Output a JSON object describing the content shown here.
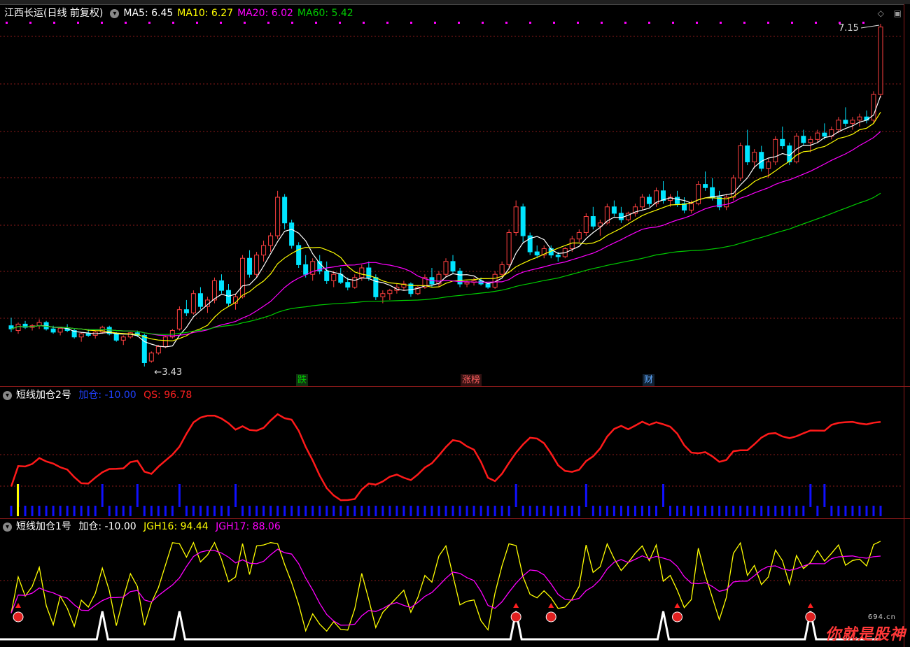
{
  "main": {
    "stock_title": "江西长运(日线 前复权)",
    "ma": [
      {
        "label": "MA5: 6.45",
        "color": "#ffffff"
      },
      {
        "label": "MA10: 6.27",
        "color": "#ffff00"
      },
      {
        "label": "MA20: 6.02",
        "color": "#ff00ff"
      },
      {
        "label": "MA60: 5.42",
        "color": "#00cc00"
      }
    ],
    "high_label": "7.15",
    "low_label": "3.43",
    "events": [
      {
        "label": "跌",
        "color": "#00cc00",
        "bg": "#113311"
      },
      {
        "label": "涨榜",
        "color": "#ff6060",
        "bg": "#331111"
      },
      {
        "label": "财",
        "color": "#5fa8ff",
        "bg": "#112233"
      }
    ]
  },
  "panel2": {
    "title": "短线加仓2号",
    "items": [
      {
        "label": "加仓: -10.00",
        "color": "#0000ff"
      },
      {
        "label": "QS: 96.78",
        "color": "#ff2020"
      }
    ]
  },
  "panel3": {
    "title": "短线加仓1号",
    "items": [
      {
        "label": "加仓: -10.00",
        "color": "#ffffff"
      },
      {
        "label": "JGH16: 94.44",
        "color": "#ffff00"
      },
      {
        "label": "JGH17: 88.06",
        "color": "#ff00ff"
      }
    ]
  },
  "toolbar": {
    "controls": [
      "◇",
      "▣"
    ]
  },
  "watermark": {
    "text": "你就是股神",
    "site": "694.cn"
  },
  "colors": {
    "up": "#ff4040",
    "down": "#00e5ff",
    "grid": "#8b1a1a"
  },
  "chart_data": {
    "type": "candlestick",
    "price_axis_shown": false,
    "candles": [
      [
        4.7,
        4.95,
        4.5,
        4.6
      ],
      [
        4.55,
        4.8,
        4.45,
        4.75
      ],
      [
        4.75,
        4.85,
        4.6,
        4.65
      ],
      [
        4.65,
        4.75,
        4.55,
        4.7
      ],
      [
        4.7,
        4.9,
        4.6,
        4.8
      ],
      [
        4.8,
        4.85,
        4.55,
        4.6
      ],
      [
        4.6,
        4.7,
        4.45,
        4.5
      ],
      [
        4.5,
        4.65,
        4.4,
        4.62
      ],
      [
        4.62,
        4.75,
        4.5,
        4.55
      ],
      [
        4.55,
        4.6,
        4.3,
        4.35
      ],
      [
        4.35,
        4.5,
        4.2,
        4.45
      ],
      [
        4.45,
        4.6,
        4.35,
        4.4
      ],
      [
        4.4,
        4.55,
        4.3,
        4.5
      ],
      [
        4.5,
        4.7,
        4.45,
        4.65
      ],
      [
        4.65,
        4.7,
        4.4,
        4.45
      ],
      [
        4.45,
        4.5,
        4.2,
        4.25
      ],
      [
        4.25,
        4.4,
        4.1,
        4.35
      ],
      [
        4.35,
        4.5,
        4.3,
        4.48
      ],
      [
        4.48,
        4.55,
        4.35,
        4.4
      ],
      [
        4.4,
        4.45,
        3.43,
        3.55
      ],
      [
        3.6,
        3.9,
        3.55,
        3.85
      ],
      [
        3.85,
        4.1,
        3.8,
        4.05
      ],
      [
        4.05,
        4.4,
        4.0,
        4.35
      ],
      [
        4.35,
        4.6,
        4.3,
        4.55
      ],
      [
        4.6,
        5.3,
        4.55,
        5.2
      ],
      [
        5.2,
        5.5,
        5.0,
        5.1
      ],
      [
        5.1,
        5.8,
        5.05,
        5.7
      ],
      [
        5.7,
        5.9,
        5.2,
        5.3
      ],
      [
        5.3,
        5.6,
        5.1,
        5.5
      ],
      [
        5.5,
        6.2,
        5.4,
        6.1
      ],
      [
        6.1,
        6.3,
        5.7,
        5.8
      ],
      [
        5.8,
        6.0,
        5.3,
        5.4
      ],
      [
        5.4,
        5.7,
        5.2,
        5.6
      ],
      [
        5.6,
        6.9,
        5.55,
        6.8
      ],
      [
        6.8,
        7.05,
        6.2,
        6.3
      ],
      [
        6.3,
        7.0,
        6.2,
        6.9
      ],
      [
        6.9,
        7.35,
        6.7,
        7.2
      ],
      [
        7.2,
        7.6,
        7.0,
        7.5
      ],
      [
        7.5,
        8.9,
        7.4,
        8.7
      ],
      [
        8.7,
        8.8,
        7.7,
        7.9
      ],
      [
        7.9,
        8.0,
        7.1,
        7.2
      ],
      [
        7.2,
        7.3,
        6.5,
        6.6
      ],
      [
        6.6,
        6.9,
        6.2,
        6.3
      ],
      [
        6.3,
        6.8,
        6.1,
        6.7
      ],
      [
        6.7,
        6.9,
        6.3,
        6.4
      ],
      [
        6.4,
        6.7,
        6.0,
        6.1
      ],
      [
        6.1,
        6.4,
        5.9,
        6.3
      ],
      [
        6.3,
        6.5,
        6.0,
        6.05
      ],
      [
        6.05,
        6.2,
        5.8,
        5.9
      ],
      [
        5.9,
        6.3,
        5.85,
        6.2
      ],
      [
        6.2,
        6.6,
        6.1,
        6.5
      ],
      [
        6.5,
        6.7,
        6.1,
        6.2
      ],
      [
        6.2,
        6.3,
        5.5,
        5.6
      ],
      [
        5.6,
        5.8,
        5.4,
        5.7
      ],
      [
        5.7,
        5.85,
        5.5,
        5.8
      ],
      [
        5.8,
        6.0,
        5.7,
        5.9
      ],
      [
        5.9,
        6.1,
        5.8,
        6.0
      ],
      [
        6.0,
        6.05,
        5.6,
        5.7
      ],
      [
        5.7,
        5.95,
        5.65,
        5.9
      ],
      [
        5.9,
        6.3,
        5.85,
        6.2
      ],
      [
        6.2,
        6.5,
        5.9,
        6.0
      ],
      [
        6.0,
        6.4,
        5.9,
        6.3
      ],
      [
        6.3,
        6.8,
        6.2,
        6.7
      ],
      [
        6.7,
        6.9,
        6.3,
        6.4
      ],
      [
        6.4,
        6.5,
        5.9,
        6.0
      ],
      [
        6.0,
        6.1,
        5.9,
        6.05
      ],
      [
        6.05,
        6.2,
        5.95,
        6.1
      ],
      [
        6.1,
        6.2,
        5.95,
        6.0
      ],
      [
        6.0,
        6.05,
        5.85,
        5.9
      ],
      [
        5.9,
        6.4,
        5.85,
        6.3
      ],
      [
        6.3,
        6.7,
        6.2,
        6.6
      ],
      [
        6.6,
        7.7,
        6.5,
        7.6
      ],
      [
        7.6,
        8.6,
        7.5,
        8.4
      ],
      [
        8.4,
        8.5,
        7.3,
        7.5
      ],
      [
        7.5,
        7.6,
        6.9,
        7.0
      ],
      [
        7.0,
        7.2,
        6.8,
        6.9
      ],
      [
        6.9,
        7.2,
        6.8,
        7.1
      ],
      [
        7.1,
        7.2,
        6.8,
        6.9
      ],
      [
        6.9,
        7.0,
        6.7,
        6.85
      ],
      [
        6.85,
        7.15,
        6.8,
        7.1
      ],
      [
        7.1,
        7.5,
        7.0,
        7.4
      ],
      [
        7.4,
        7.7,
        7.3,
        7.6
      ],
      [
        7.6,
        8.2,
        7.5,
        8.1
      ],
      [
        8.1,
        8.4,
        7.7,
        7.8
      ],
      [
        7.8,
        8.0,
        7.5,
        7.9
      ],
      [
        7.9,
        8.5,
        7.85,
        8.4
      ],
      [
        8.4,
        8.6,
        8.1,
        8.2
      ],
      [
        8.2,
        8.4,
        7.9,
        8.0
      ],
      [
        8.0,
        8.25,
        7.95,
        8.2
      ],
      [
        8.2,
        8.5,
        8.1,
        8.4
      ],
      [
        8.4,
        8.8,
        8.3,
        8.7
      ],
      [
        8.7,
        8.8,
        8.4,
        8.5
      ],
      [
        8.5,
        9.0,
        8.4,
        8.9
      ],
      [
        8.9,
        9.2,
        8.5,
        8.6
      ],
      [
        8.6,
        8.8,
        8.4,
        8.7
      ],
      [
        8.7,
        8.9,
        8.4,
        8.5
      ],
      [
        8.5,
        8.7,
        8.2,
        8.3
      ],
      [
        8.3,
        8.6,
        8.2,
        8.5
      ],
      [
        8.5,
        9.2,
        8.45,
        9.1
      ],
      [
        9.1,
        9.5,
        8.9,
        9.0
      ],
      [
        9.0,
        9.3,
        8.6,
        8.7
      ],
      [
        8.7,
        8.9,
        8.3,
        8.4
      ],
      [
        8.4,
        8.8,
        8.3,
        8.7
      ],
      [
        8.7,
        9.4,
        8.6,
        9.3
      ],
      [
        9.3,
        10.4,
        9.2,
        10.3
      ],
      [
        10.3,
        10.8,
        9.7,
        9.8
      ],
      [
        9.8,
        10.2,
        9.6,
        10.1
      ],
      [
        10.1,
        10.3,
        9.5,
        9.6
      ],
      [
        9.6,
        9.9,
        9.3,
        9.8
      ],
      [
        9.8,
        10.6,
        9.7,
        10.5
      ],
      [
        10.5,
        10.9,
        10.2,
        10.3
      ],
      [
        10.3,
        10.4,
        9.7,
        9.8
      ],
      [
        9.8,
        10.7,
        9.75,
        10.6
      ],
      [
        10.6,
        10.8,
        10.3,
        10.4
      ],
      [
        10.4,
        10.6,
        10.1,
        10.5
      ],
      [
        10.5,
        10.8,
        10.4,
        10.7
      ],
      [
        10.7,
        11.0,
        10.5,
        10.6
      ],
      [
        10.6,
        10.9,
        10.5,
        10.8
      ],
      [
        10.8,
        11.2,
        10.7,
        11.1
      ],
      [
        11.1,
        11.5,
        10.9,
        11.0
      ],
      [
        11.0,
        11.2,
        10.8,
        11.1
      ],
      [
        11.1,
        11.3,
        10.9,
        11.2
      ],
      [
        11.2,
        11.4,
        11.0,
        11.1
      ],
      [
        11.1,
        12.0,
        11.0,
        11.9
      ],
      [
        11.9,
        14.1,
        11.8,
        14.0
      ]
    ]
  }
}
